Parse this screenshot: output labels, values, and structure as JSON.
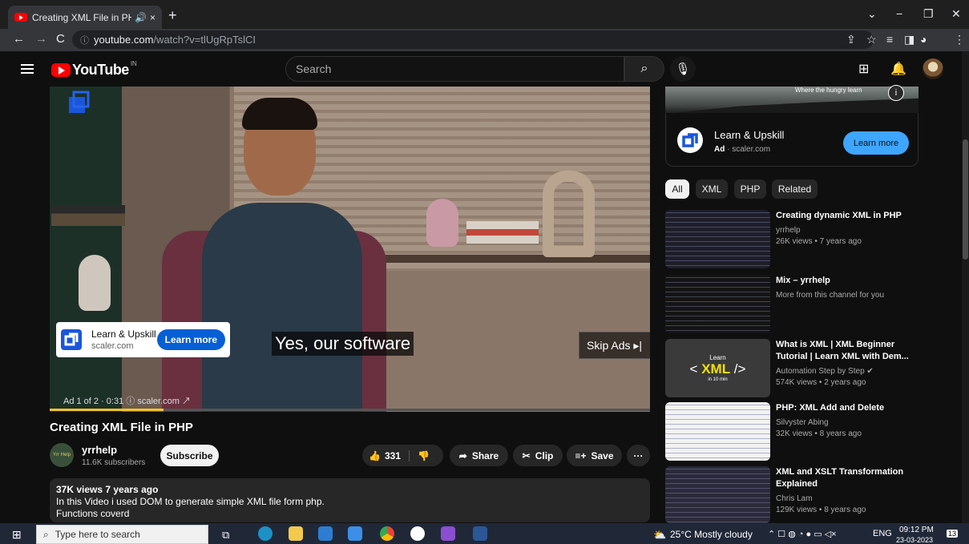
{
  "browser": {
    "tab_title": "Creating XML File in PHP - Yo",
    "tab_audio_icon": "speaker-icon",
    "tab_close": "×",
    "new_tab": "+",
    "url_host": "youtube.com",
    "url_path": "/watch?v=tlUgRpTslCI",
    "win_min": "−",
    "win_max": "❐",
    "win_close": "✕",
    "tab_search": "⌄"
  },
  "yt": {
    "region": "IN",
    "logo_text": "YouTube",
    "search_placeholder": "Search"
  },
  "player": {
    "ad_card": {
      "name": "Learn & Upskill",
      "domain": "scaler.com",
      "button": "Learn more"
    },
    "subtitle": "Yes, our software",
    "skip": "Skip Ads ▸|",
    "ad_info": "Ad 1 of 2 · 0:31 ⓘ  scaler.com ↗",
    "progress": 0.19
  },
  "video": {
    "title": "Creating XML File in PHP",
    "channel": "yrrhelp",
    "channel_avatar_text": "Yrr Help",
    "subscribers": "11.6K subscribers",
    "subscribe": "Subscribe",
    "likes": "331",
    "share": "Share",
    "clip": "Clip",
    "save": "Save",
    "more": "···",
    "views_line": "37K views  7 years ago",
    "desc_line1": "In this Video i used DOM to generate simple XML file form php.",
    "desc_line2": "Functions coverd"
  },
  "side_ad": {
    "banner_tag": "Where the hungry learn",
    "name": "Learn & Upskill",
    "ad_label": "Ad",
    "domain": "scaler.com",
    "button": "Learn more"
  },
  "chips": [
    "All",
    "XML",
    "PHP",
    "Related"
  ],
  "recs": [
    {
      "title": "Creating dynamic XML in PHP",
      "channel": "yrrhelp",
      "meta": "26K views  • 7 years ago"
    },
    {
      "title": "Mix – yrrhelp",
      "channel": "More from this channel for you",
      "meta": ""
    },
    {
      "title": "What is XML | XML Beginner Tutorial | Learn XML with Dem...",
      "channel": "Automation Step by Step ✔",
      "meta": "574K views  • 2 years ago",
      "thumb_l1": "Learn",
      "thumb_l2a": "< ",
      "thumb_l2b": "XML",
      "thumb_l2c": " />",
      "thumb_l3": "in 10 min"
    },
    {
      "title": "PHP: XML Add and Delete",
      "channel": "Silvyster Abing",
      "meta": "32K views  • 8 years ago"
    },
    {
      "title": "XML and XSLT Transformation Explained",
      "channel": "Chris Lam",
      "meta": "129K views  • 8 years ago"
    }
  ],
  "taskbar": {
    "search_placeholder": "Type here to search",
    "weather": "25°C  Mostly cloudy",
    "lang": "ENG",
    "time": "09:12 PM",
    "date": "23-03-2023",
    "notif": "13"
  },
  "colors": {
    "yt_red": "#ff0000",
    "ad_blue": "#065fd4",
    "link_blue": "#3ea6ff",
    "progress_yellow": "#f2c32e"
  }
}
